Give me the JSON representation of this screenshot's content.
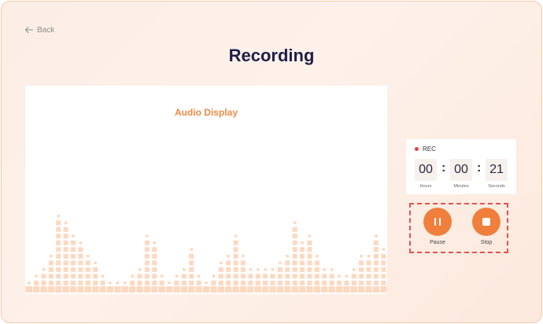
{
  "nav": {
    "back_label": "Back"
  },
  "page": {
    "title": "Recording"
  },
  "audio": {
    "title": "Audio Display",
    "levels": [
      1,
      2,
      3,
      5,
      11,
      10,
      8,
      7,
      5,
      4,
      2,
      1,
      1,
      1,
      2,
      3,
      8,
      7,
      2,
      1,
      2,
      3,
      6,
      2,
      1,
      2,
      4,
      5,
      8,
      5,
      3,
      3,
      3,
      3,
      4,
      5,
      10,
      7,
      8,
      5,
      3,
      3,
      2,
      2,
      3,
      5,
      5,
      8,
      6
    ]
  },
  "timer": {
    "rec_label": "REC",
    "hours": "00",
    "minutes": "00",
    "seconds": "21",
    "hours_label": "Hours",
    "minutes_label": "Minutes",
    "seconds_label": "Seconds"
  },
  "controls": {
    "pause_label": "Pause",
    "stop_label": "Stop"
  },
  "colors": {
    "accent": "#f07f3c",
    "title": "#1f1f4a",
    "rec": "#e84141",
    "equalizer": "#fdd8c0",
    "dash": "#e8514c"
  }
}
